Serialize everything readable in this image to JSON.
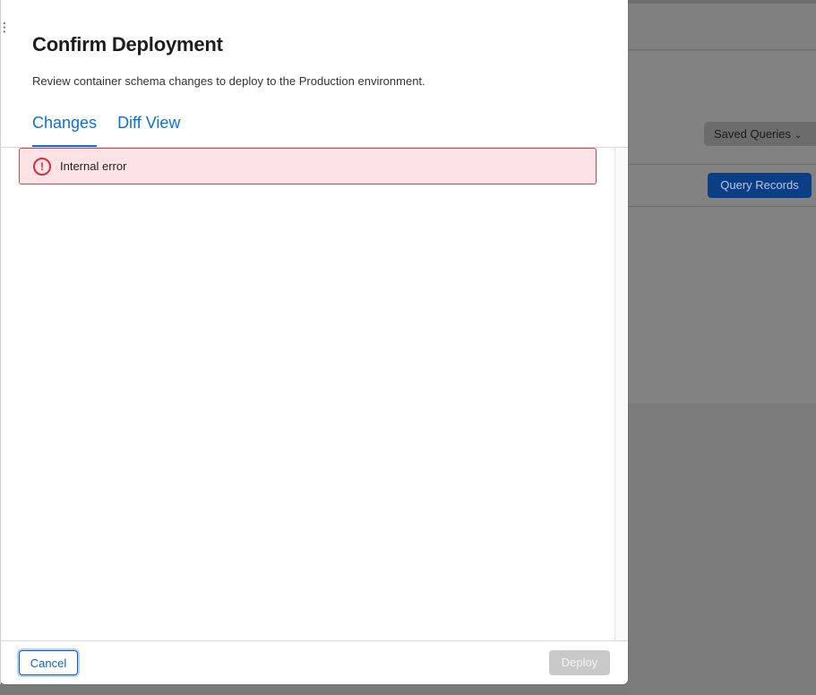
{
  "background": {
    "saved_queries_label": "Saved Queries",
    "query_records_label": "Query Records"
  },
  "modal": {
    "title": "Confirm Deployment",
    "subtitle": "Review container schema changes to deploy to the Production environment.",
    "tabs": [
      {
        "label": "Changes",
        "active": true
      },
      {
        "label": "Diff View",
        "active": false
      }
    ],
    "error": {
      "icon": "exclamation-circle-icon",
      "message": "Internal error"
    },
    "footer": {
      "cancel_label": "Cancel",
      "deploy_label": "Deploy",
      "deploy_enabled": false
    }
  },
  "colors": {
    "accent": "#0a72d6",
    "error_border": "#d9434b",
    "error_bg": "#fde3e5"
  }
}
